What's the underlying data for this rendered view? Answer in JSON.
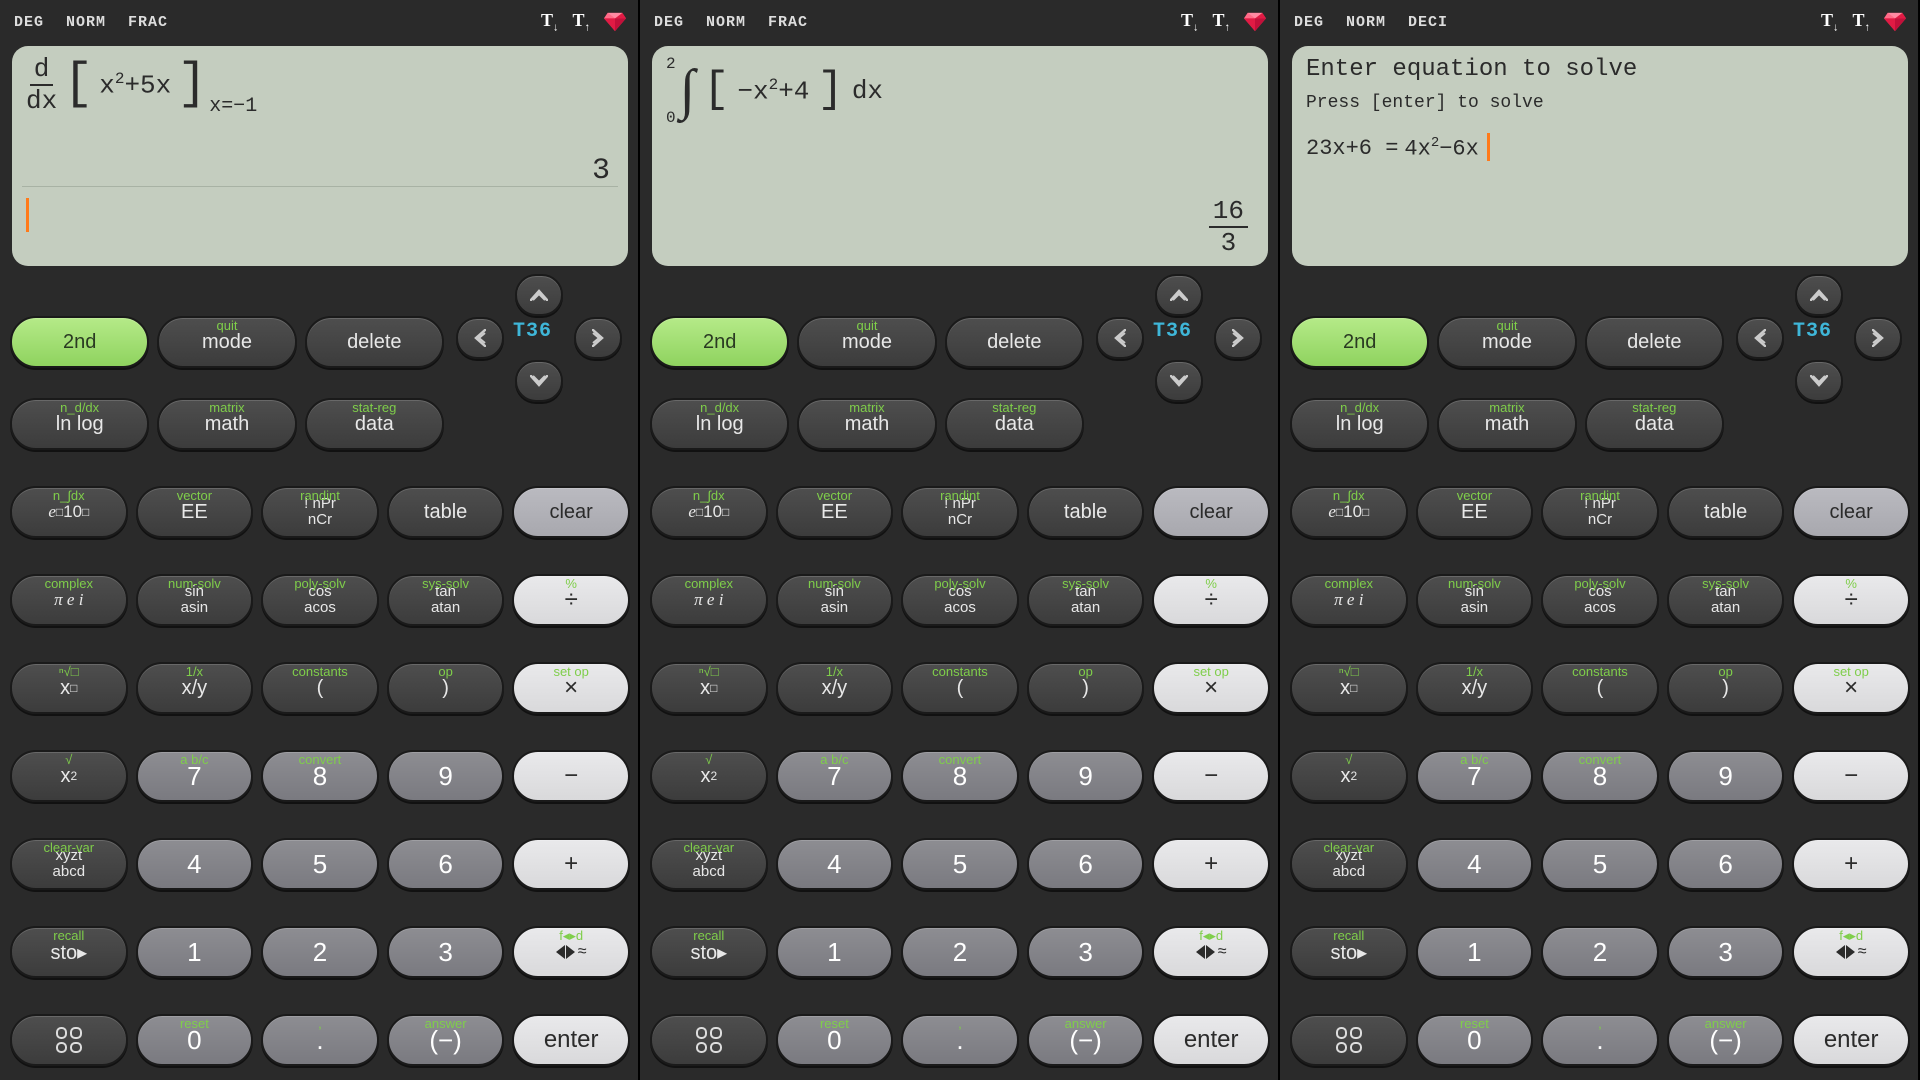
{
  "calcs": [
    {
      "modes": [
        "DEG",
        "NORM",
        "FRAC"
      ]
    },
    {
      "modes": [
        "DEG",
        "NORM",
        "FRAC"
      ]
    },
    {
      "modes": [
        "DEG",
        "NORM",
        "DECI"
      ]
    }
  ],
  "nav_mid": "T36",
  "screen1": {
    "deriv_top": "d",
    "deriv_bot": "dx",
    "expr_a": "x",
    "expr_a_pow": "2",
    "expr_b": "+5x",
    "at": "x=−1",
    "result": "3"
  },
  "screen2": {
    "upper": "2",
    "lower": "0",
    "expr_a": "−x",
    "expr_a_pow": "2",
    "expr_b": "+4",
    "dx": "dx",
    "res_num": "16",
    "res_den": "3"
  },
  "screen3": {
    "title": "Enter equation to solve",
    "sub": "Press [enter] to solve",
    "lhs": "23x+6 =",
    "rhs_a": "4x",
    "rhs_pow": "2",
    "rhs_b": "−6x"
  },
  "btn": {
    "second": "2nd",
    "mode": "mode",
    "delete": "delete",
    "lnlog": "ln log",
    "math": "math",
    "data": "data",
    "eten": "e",
    "tensup": "□",
    "tenb": " 10",
    "ee": "EE",
    "npr": "! nPr",
    "ncr": "nCr",
    "table": "table",
    "clear": "clear",
    "pei_p": "π",
    "pei_e": "e",
    "pei_i": "i",
    "sin": "sin",
    "asin": "asin",
    "cos": "cos",
    "acos": "acos",
    "tan": "tan",
    "atan": "atan",
    "div": "÷",
    "xpow": "x",
    "xpow_s": "□",
    "xy": "x/y",
    "lp": "(",
    "rp": ")",
    "mul": "×",
    "xsq": "x",
    "xsq_s": "2",
    "n7": "7",
    "n8": "8",
    "n9": "9",
    "minus": "−",
    "xyzt": "xyzt",
    "abcd": "abcd",
    "n4": "4",
    "n5": "5",
    "n6": "6",
    "plus": "+",
    "sto": "sto▸",
    "n1": "1",
    "n2": "2",
    "n3": "3",
    "n0": "0",
    "dot": ".",
    "neg": "(−)",
    "enter": "enter"
  },
  "sec": {
    "quit": "quit",
    "nddx": "n_d/dx",
    "matrix": "matrix",
    "statreg": "stat-reg",
    "nint": "n_∫dx",
    "vector": "vector",
    "randint": "randint",
    "complex": "complex",
    "numsolv": "num-solv",
    "polysolv": "poly-solv",
    "syssolv": "sys-solv",
    "pct": "%",
    "root": "ⁿ√□",
    "inv": "1/x",
    "const": "constants",
    "op": "op",
    "setop": "set op",
    "sqrt": "√",
    "abc": "a b/c",
    "conv": "convert",
    "clrvar": "clear-var",
    "recall": "recall",
    "fd": "f◂▸d",
    "reset": "reset",
    "comma": ",",
    "answer": "answer"
  }
}
